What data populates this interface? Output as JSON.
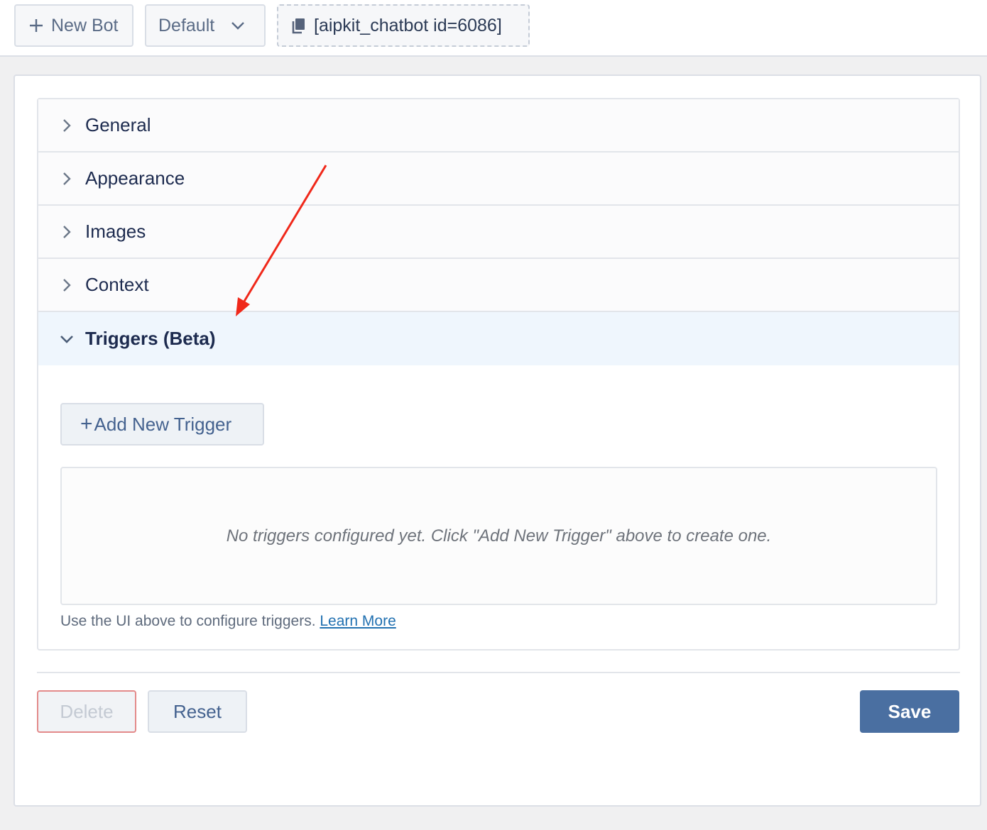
{
  "toolbar": {
    "new_bot_label": "New Bot",
    "bot_select_value": "Default",
    "shortcode": "[aipkit_chatbot id=6086]"
  },
  "accordion": {
    "sections": [
      {
        "label": "General",
        "open": false
      },
      {
        "label": "Appearance",
        "open": false
      },
      {
        "label": "Images",
        "open": false
      },
      {
        "label": "Context",
        "open": false
      },
      {
        "label": "Triggers (Beta)",
        "open": true
      }
    ]
  },
  "triggers": {
    "add_button_label": "Add New Trigger",
    "empty_message": "No triggers configured yet. Click \"Add New Trigger\" above to create one.",
    "help_text": "Use the UI above to configure triggers.",
    "learn_more_label": "Learn More"
  },
  "footer": {
    "delete_label": "Delete",
    "reset_label": "Reset",
    "save_label": "Save"
  },
  "colors": {
    "accent": "#4a6fa1",
    "annotation_arrow": "#f0281a",
    "link": "#2271b1"
  }
}
